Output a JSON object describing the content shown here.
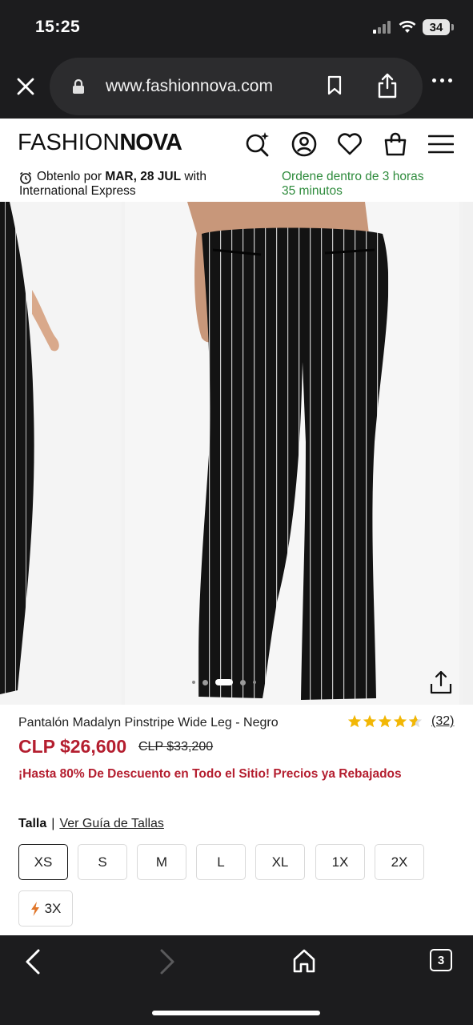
{
  "status_bar": {
    "time": "15:25",
    "battery": "34"
  },
  "browser": {
    "url": "www.fashionnova.com",
    "icons": [
      "close-icon",
      "lock-icon",
      "bookmark-icon",
      "share-icon",
      "more-icon"
    ]
  },
  "header": {
    "logo_light": "FASHION",
    "logo_bold": "NOVA",
    "icons": [
      "search-sparkle-icon",
      "account-icon",
      "heart-icon",
      "bag-icon",
      "menu-icon"
    ]
  },
  "shipping": {
    "prefix": "Obtenlo por ",
    "date": "MAR, 28 JUL",
    "with": " with",
    "carrier": "International Express",
    "order_window_line1": "Ordene dentro de 3 horas",
    "order_window_line2": "35 minutos",
    "order_color": "#2e8b3c"
  },
  "gallery": {
    "slide_count": 5,
    "active_slide": 3
  },
  "product": {
    "title": "Pantalón Madalyn Pinstripe Wide Leg - Negro",
    "rating": 4.5,
    "review_count": "(32)",
    "price": "CLP $26,600",
    "original_price": "CLP $33,200",
    "promo": "¡Hasta 80% De Descuento en Todo el Sitio! Precios ya Rebajados",
    "price_color": "#b41e2f",
    "star_color": "#f2b705"
  },
  "sizes": {
    "label": "Talla",
    "separator": "|",
    "guide_link": "Ver Guía de Tallas",
    "options": [
      "XS",
      "S",
      "M",
      "L",
      "XL",
      "1X",
      "2X",
      "3X"
    ],
    "selected": "XS",
    "low_stock_badge_icon": "bolt-icon"
  },
  "bottom_toolbar": {
    "icons": [
      "back-icon",
      "forward-icon",
      "home-icon",
      "tabs-icon"
    ],
    "tabs_count": "3"
  }
}
